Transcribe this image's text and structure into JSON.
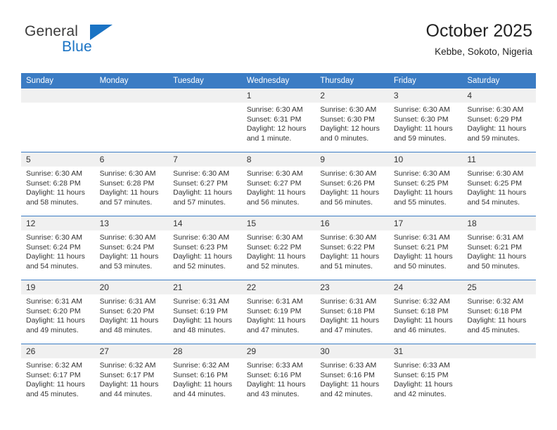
{
  "logo": {
    "word1": "General",
    "word2": "Blue",
    "triangle": "blue-triangle-icon",
    "color_dark": "#3c3c3c",
    "color_blue": "#1a73c4"
  },
  "header": {
    "title": "October 2025",
    "subtitle": "Kebbe, Sokoto, Nigeria"
  },
  "theme": {
    "header_blue": "#3b7cc4",
    "daynum_band": "#f0f0f0",
    "text": "#333333"
  },
  "weekdays": [
    "Sunday",
    "Monday",
    "Tuesday",
    "Wednesday",
    "Thursday",
    "Friday",
    "Saturday"
  ],
  "labels": {
    "sunrise": "Sunrise:",
    "sunset": "Sunset:",
    "daylight": "Daylight:"
  },
  "weeks": [
    [
      {
        "day": "",
        "empty": true
      },
      {
        "day": "",
        "empty": true
      },
      {
        "day": "",
        "empty": true
      },
      {
        "day": "1",
        "sunrise": "Sunrise: 6:30 AM",
        "sunset": "Sunset: 6:31 PM",
        "daylight1": "Daylight: 12 hours",
        "daylight2": "and 1 minute."
      },
      {
        "day": "2",
        "sunrise": "Sunrise: 6:30 AM",
        "sunset": "Sunset: 6:30 PM",
        "daylight1": "Daylight: 12 hours",
        "daylight2": "and 0 minutes."
      },
      {
        "day": "3",
        "sunrise": "Sunrise: 6:30 AM",
        "sunset": "Sunset: 6:30 PM",
        "daylight1": "Daylight: 11 hours",
        "daylight2": "and 59 minutes."
      },
      {
        "day": "4",
        "sunrise": "Sunrise: 6:30 AM",
        "sunset": "Sunset: 6:29 PM",
        "daylight1": "Daylight: 11 hours",
        "daylight2": "and 59 minutes."
      }
    ],
    [
      {
        "day": "5",
        "sunrise": "Sunrise: 6:30 AM",
        "sunset": "Sunset: 6:28 PM",
        "daylight1": "Daylight: 11 hours",
        "daylight2": "and 58 minutes."
      },
      {
        "day": "6",
        "sunrise": "Sunrise: 6:30 AM",
        "sunset": "Sunset: 6:28 PM",
        "daylight1": "Daylight: 11 hours",
        "daylight2": "and 57 minutes."
      },
      {
        "day": "7",
        "sunrise": "Sunrise: 6:30 AM",
        "sunset": "Sunset: 6:27 PM",
        "daylight1": "Daylight: 11 hours",
        "daylight2": "and 57 minutes."
      },
      {
        "day": "8",
        "sunrise": "Sunrise: 6:30 AM",
        "sunset": "Sunset: 6:27 PM",
        "daylight1": "Daylight: 11 hours",
        "daylight2": "and 56 minutes."
      },
      {
        "day": "9",
        "sunrise": "Sunrise: 6:30 AM",
        "sunset": "Sunset: 6:26 PM",
        "daylight1": "Daylight: 11 hours",
        "daylight2": "and 56 minutes."
      },
      {
        "day": "10",
        "sunrise": "Sunrise: 6:30 AM",
        "sunset": "Sunset: 6:25 PM",
        "daylight1": "Daylight: 11 hours",
        "daylight2": "and 55 minutes."
      },
      {
        "day": "11",
        "sunrise": "Sunrise: 6:30 AM",
        "sunset": "Sunset: 6:25 PM",
        "daylight1": "Daylight: 11 hours",
        "daylight2": "and 54 minutes."
      }
    ],
    [
      {
        "day": "12",
        "sunrise": "Sunrise: 6:30 AM",
        "sunset": "Sunset: 6:24 PM",
        "daylight1": "Daylight: 11 hours",
        "daylight2": "and 54 minutes."
      },
      {
        "day": "13",
        "sunrise": "Sunrise: 6:30 AM",
        "sunset": "Sunset: 6:24 PM",
        "daylight1": "Daylight: 11 hours",
        "daylight2": "and 53 minutes."
      },
      {
        "day": "14",
        "sunrise": "Sunrise: 6:30 AM",
        "sunset": "Sunset: 6:23 PM",
        "daylight1": "Daylight: 11 hours",
        "daylight2": "and 52 minutes."
      },
      {
        "day": "15",
        "sunrise": "Sunrise: 6:30 AM",
        "sunset": "Sunset: 6:22 PM",
        "daylight1": "Daylight: 11 hours",
        "daylight2": "and 52 minutes."
      },
      {
        "day": "16",
        "sunrise": "Sunrise: 6:30 AM",
        "sunset": "Sunset: 6:22 PM",
        "daylight1": "Daylight: 11 hours",
        "daylight2": "and 51 minutes."
      },
      {
        "day": "17",
        "sunrise": "Sunrise: 6:31 AM",
        "sunset": "Sunset: 6:21 PM",
        "daylight1": "Daylight: 11 hours",
        "daylight2": "and 50 minutes."
      },
      {
        "day": "18",
        "sunrise": "Sunrise: 6:31 AM",
        "sunset": "Sunset: 6:21 PM",
        "daylight1": "Daylight: 11 hours",
        "daylight2": "and 50 minutes."
      }
    ],
    [
      {
        "day": "19",
        "sunrise": "Sunrise: 6:31 AM",
        "sunset": "Sunset: 6:20 PM",
        "daylight1": "Daylight: 11 hours",
        "daylight2": "and 49 minutes."
      },
      {
        "day": "20",
        "sunrise": "Sunrise: 6:31 AM",
        "sunset": "Sunset: 6:20 PM",
        "daylight1": "Daylight: 11 hours",
        "daylight2": "and 48 minutes."
      },
      {
        "day": "21",
        "sunrise": "Sunrise: 6:31 AM",
        "sunset": "Sunset: 6:19 PM",
        "daylight1": "Daylight: 11 hours",
        "daylight2": "and 48 minutes."
      },
      {
        "day": "22",
        "sunrise": "Sunrise: 6:31 AM",
        "sunset": "Sunset: 6:19 PM",
        "daylight1": "Daylight: 11 hours",
        "daylight2": "and 47 minutes."
      },
      {
        "day": "23",
        "sunrise": "Sunrise: 6:31 AM",
        "sunset": "Sunset: 6:18 PM",
        "daylight1": "Daylight: 11 hours",
        "daylight2": "and 47 minutes."
      },
      {
        "day": "24",
        "sunrise": "Sunrise: 6:32 AM",
        "sunset": "Sunset: 6:18 PM",
        "daylight1": "Daylight: 11 hours",
        "daylight2": "and 46 minutes."
      },
      {
        "day": "25",
        "sunrise": "Sunrise: 6:32 AM",
        "sunset": "Sunset: 6:18 PM",
        "daylight1": "Daylight: 11 hours",
        "daylight2": "and 45 minutes."
      }
    ],
    [
      {
        "day": "26",
        "sunrise": "Sunrise: 6:32 AM",
        "sunset": "Sunset: 6:17 PM",
        "daylight1": "Daylight: 11 hours",
        "daylight2": "and 45 minutes."
      },
      {
        "day": "27",
        "sunrise": "Sunrise: 6:32 AM",
        "sunset": "Sunset: 6:17 PM",
        "daylight1": "Daylight: 11 hours",
        "daylight2": "and 44 minutes."
      },
      {
        "day": "28",
        "sunrise": "Sunrise: 6:32 AM",
        "sunset": "Sunset: 6:16 PM",
        "daylight1": "Daylight: 11 hours",
        "daylight2": "and 44 minutes."
      },
      {
        "day": "29",
        "sunrise": "Sunrise: 6:33 AM",
        "sunset": "Sunset: 6:16 PM",
        "daylight1": "Daylight: 11 hours",
        "daylight2": "and 43 minutes."
      },
      {
        "day": "30",
        "sunrise": "Sunrise: 6:33 AM",
        "sunset": "Sunset: 6:16 PM",
        "daylight1": "Daylight: 11 hours",
        "daylight2": "and 42 minutes."
      },
      {
        "day": "31",
        "sunrise": "Sunrise: 6:33 AM",
        "sunset": "Sunset: 6:15 PM",
        "daylight1": "Daylight: 11 hours",
        "daylight2": "and 42 minutes."
      },
      {
        "day": "",
        "empty": true
      }
    ]
  ]
}
